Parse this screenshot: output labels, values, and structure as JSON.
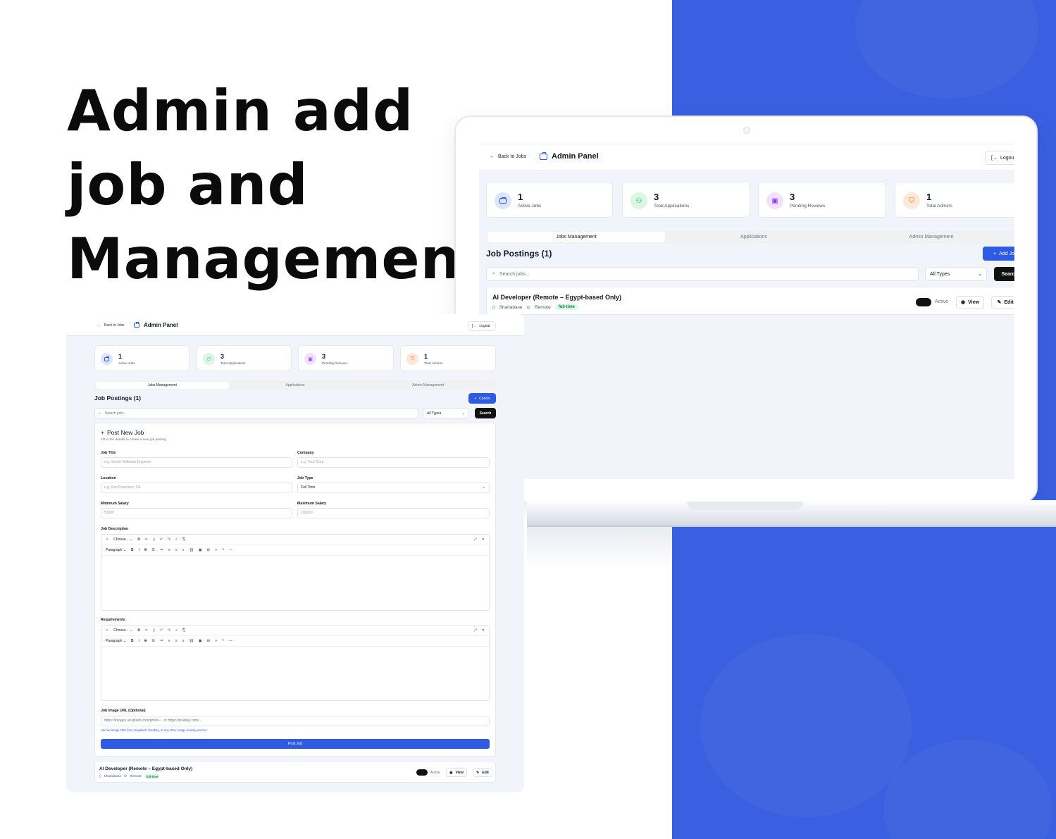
{
  "hero": {
    "line1": "Admin add",
    "line2": "job and",
    "line3": "Management"
  },
  "panel": {
    "back_label": "Back to Jobs",
    "title": "Admin Panel",
    "logout_label": "Logout",
    "logout_label_cropped": "Logou"
  },
  "stats": [
    {
      "value": "1",
      "label": "Active Jobs",
      "icon": "briefcase-icon",
      "color": "#2d5be3"
    },
    {
      "value": "3",
      "label": "Total Applications",
      "icon": "users-icon",
      "color": "#16a34a"
    },
    {
      "value": "3",
      "label": "Pending Reviews",
      "icon": "calendar-icon",
      "color": "#9333ea"
    },
    {
      "value": "1",
      "label": "Total Admins",
      "icon": "shield-icon",
      "color": "#ea580c"
    }
  ],
  "tabs": [
    "Jobs Management",
    "Applications",
    "Admin Management"
  ],
  "jobs_section": {
    "title": "Job Postings (1)",
    "add_label": "Add Job",
    "add_label_cropped": "Add Jo",
    "cancel_label": "Cancel",
    "search_placeholder": "Search jobs...",
    "type_filter": "All Types",
    "search_button": "Search",
    "search_button_cropped": "Searc"
  },
  "job": {
    "title": "AI Developer (Remote – Egypt-based Only)",
    "company": "Shariabase",
    "location": "Remote",
    "type_badge": "full-time",
    "status_label": "Active",
    "view_label": "View",
    "edit_label": "Edit"
  },
  "form": {
    "title": "Post New Job",
    "subtitle": "Fill in the details to create a new job posting",
    "job_title_label": "Job Title",
    "job_title_placeholder": "e.g. Senior Software Engineer",
    "company_label": "Company",
    "company_placeholder": "e.g. Tech Corp",
    "location_label": "Location",
    "location_placeholder": "e.g. San Francisco, CA",
    "job_type_label": "Job Type",
    "job_type_value": "Full Time",
    "min_salary_label": "Minimum Salary",
    "min_salary_placeholder": "50000",
    "max_salary_label": "Maximum Salary",
    "max_salary_placeholder": "100000",
    "description_label": "Job Description",
    "requirements_label": "Requirements",
    "editor_choose": "Choose...",
    "editor_paragraph": "Paragraph",
    "image_url_label": "Job Image URL (Optional)",
    "image_url_placeholder": "https://images.unsplash.com/photo-... or https://pixabay.com/...",
    "image_url_hint": "Add an image URL from Unsplash, Pixabay, or any other image hosting service",
    "submit_label": "Post Job"
  }
}
